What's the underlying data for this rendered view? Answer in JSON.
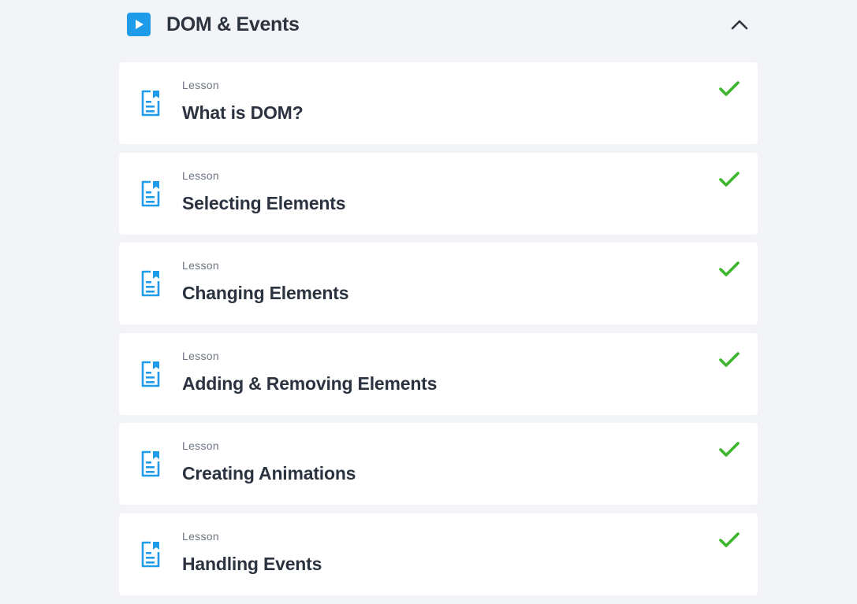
{
  "section": {
    "title": "DOM & Events",
    "icon": "play-icon",
    "toggle_icon": "chevron-up-icon",
    "expanded": true
  },
  "lessons": [
    {
      "type": "Lesson",
      "title": "What is DOM?",
      "completed": true
    },
    {
      "type": "Lesson",
      "title": "Selecting Elements",
      "completed": true
    },
    {
      "type": "Lesson",
      "title": "Changing Elements",
      "completed": true
    },
    {
      "type": "Lesson",
      "title": "Adding & Removing Elements",
      "completed": true
    },
    {
      "type": "Lesson",
      "title": "Creating Animations",
      "completed": true
    },
    {
      "type": "Lesson",
      "title": "Handling Events",
      "completed": true
    }
  ],
  "icons": {
    "lesson": "document-icon",
    "completed": "checkmark-icon"
  },
  "colors": {
    "background": "#f2f4f7",
    "accent": "#1e9be9",
    "check": "#3db52c",
    "title": "#2b3340",
    "muted": "#6b7480"
  }
}
